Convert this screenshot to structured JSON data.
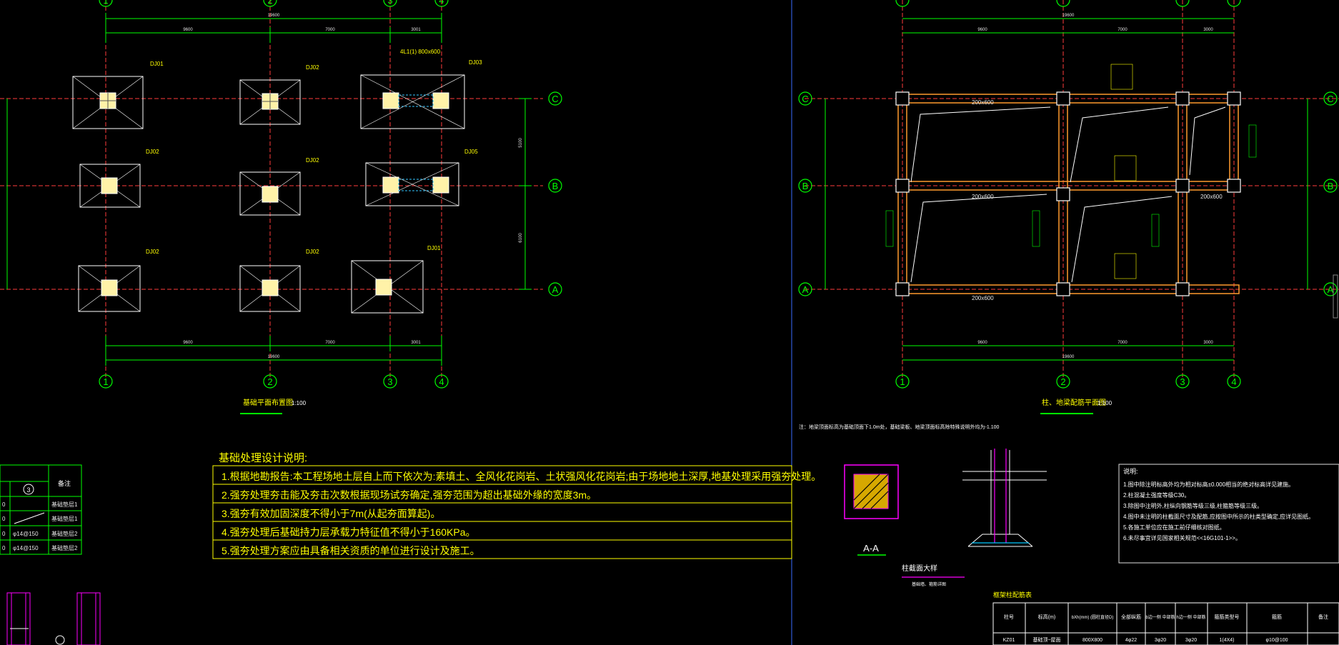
{
  "left_plan": {
    "title": "基础平面布置图",
    "scale": "1:100",
    "grid_cols": [
      "1",
      "2",
      "3",
      "4"
    ],
    "grid_rows": [
      "C",
      "B",
      "A"
    ],
    "top_dims": {
      "overall": "19600",
      "spans": [
        "9600",
        "7000",
        "3001"
      ]
    },
    "bottom_dims": {
      "overall": "19600",
      "spans": [
        "9600",
        "7000",
        "3001"
      ]
    },
    "right_dims": [
      "5100",
      "6100"
    ],
    "footings": [
      {
        "label": "DJ01"
      },
      {
        "label": "DJ02"
      },
      {
        "label": "DJ03"
      },
      {
        "label": "DJ02"
      },
      {
        "label": "DJ02"
      },
      {
        "label": "DJ05"
      },
      {
        "label": "DJ02"
      },
      {
        "label": "DJ02"
      },
      {
        "label": "DJ01"
      }
    ],
    "beam_note": "4L1(1) 800x600"
  },
  "right_plan": {
    "title": "柱、地梁配筋平面图",
    "scale": "1:100",
    "grid_cols": [
      "1",
      "2",
      "3",
      "4"
    ],
    "grid_rows": [
      "C",
      "B",
      "A"
    ],
    "top_dims": {
      "overall": "19600",
      "spans": [
        "9600",
        "7000",
        "3000"
      ]
    },
    "bottom_dims": {
      "overall": "19600",
      "spans": [
        "9600",
        "7000",
        "3000"
      ]
    },
    "beam_labels": [
      "200x600",
      "200x600",
      "200x600",
      "200x600"
    ],
    "note_above_details": "注：地梁顶面标高为基础顶面下1.0m处，基础梁板、地梁顶面标高除特殊说明外均为-1.100"
  },
  "foundation_notes": {
    "title": "基础处理设计说明:",
    "lines": [
      "1.根据地勘报告:本工程场地土层自上而下依次为:素填土、全风化花岗岩、土状强风化花岗岩;由于场地地土深厚,地基处理采用强夯处理。",
      "2.强夯处理夯击能及夯击次数根据现场试夯确定,强夯范围为超出基础外缘的宽度3m。",
      "3.强夯有效加固深度不得小于7m(从起夯面算起)。",
      "4.强夯处理后基础持力层承载力特征值不得小于160KPa。",
      "5.强夯处理方案应由具备相关资质的单位进行设计及施工。"
    ]
  },
  "design_notes": {
    "title": "说明:",
    "lines": [
      "1.图中除注明标高外均为相对标高±0.000相当的绝对标高详见建施。",
      "2.柱混凝土强度等级C30。",
      "3.除图中注明外,柱纵向钢筋等级三级,柱箍筋等级三级。",
      "4.图中未注明的柱截面尺寸及配筋,应按图中所示的柱类型确定,应详见图纸。",
      "5.各施工单位应在施工前仔细核对图纸。",
      "6.未尽事宜详见国家相关规范<<16G101-1>>。"
    ]
  },
  "left_table": {
    "circle": "3",
    "header": "备注",
    "rows": [
      {
        "left": "0",
        "mid": "",
        "remark": "基础垫层1"
      },
      {
        "left": "0",
        "mid": "",
        "remark": "基础垫层1"
      },
      {
        "left": "0",
        "mid": "φ14@150",
        "remark": "基础垫层2"
      },
      {
        "left": "0",
        "mid": "φ14@150",
        "remark": "基础垫层2"
      }
    ]
  },
  "detail_aa": {
    "label": "A-A"
  },
  "column_detail": {
    "title": "柱截面大样",
    "subtitle": "基础墙、箍筋详图"
  },
  "schedule": {
    "title": "框架柱配筋表",
    "headers": [
      "柱号",
      "标高(m)",
      "bXh(mm) (圆柱直径D)",
      "全部纵筋",
      "b边一侧 中部筋",
      "h边一侧 中部筋",
      "箍筋类型号",
      "箍筋",
      "备注"
    ],
    "row": [
      "KZ01",
      "基础顶~屋面",
      "800X800",
      "4φ22",
      "3φ20",
      "3φ20",
      "1(4X4)",
      "φ10@100",
      ""
    ]
  },
  "colors": {
    "background": "#000000",
    "gridline": "#ff3b3b",
    "dimension": "#00ff00",
    "footing": "#ffffff",
    "column_fill": "#fff2a8",
    "beam": "#ff9a2e",
    "text_yellow": "#ffff00",
    "rebar_green": "#00ff00",
    "magenta": "#ff00ff",
    "divider": "#3a6bff"
  }
}
